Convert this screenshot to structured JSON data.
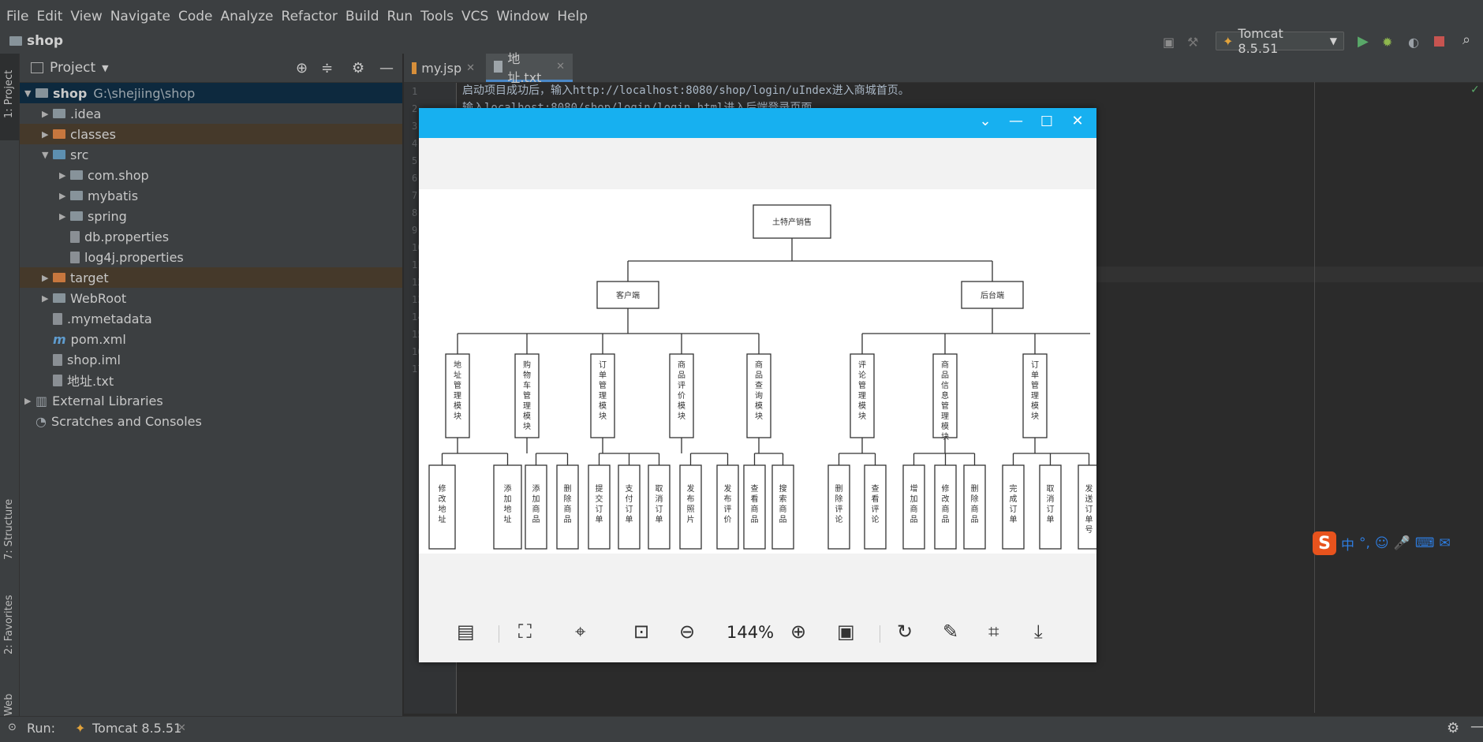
{
  "menu": [
    "File",
    "Edit",
    "View",
    "Navigate",
    "Code",
    "Analyze",
    "Refactor",
    "Build",
    "Run",
    "Tools",
    "VCS",
    "Window",
    "Help"
  ],
  "project_name": "shop",
  "run_config": "Tomcat 8.5.51",
  "project_panel": {
    "title": "Project",
    "tree": [
      {
        "label": "shop",
        "extra": "G:\\shejiing\\shop",
        "indent": 0,
        "arrow": "▼",
        "icon": "folder",
        "selected": true
      },
      {
        "label": ".idea",
        "indent": 1,
        "arrow": "▶",
        "icon": "folder"
      },
      {
        "label": "classes",
        "indent": 1,
        "arrow": "▶",
        "icon": "folder-orange",
        "excluded": true
      },
      {
        "label": "src",
        "indent": 1,
        "arrow": "▼",
        "icon": "folder-blue"
      },
      {
        "label": "com.shop",
        "indent": 2,
        "arrow": "▶",
        "icon": "package"
      },
      {
        "label": "mybatis",
        "indent": 2,
        "arrow": "▶",
        "icon": "package"
      },
      {
        "label": "spring",
        "indent": 2,
        "arrow": "▶",
        "icon": "package"
      },
      {
        "label": "db.properties",
        "indent": 2,
        "arrow": "",
        "icon": "file"
      },
      {
        "label": "log4j.properties",
        "indent": 2,
        "arrow": "",
        "icon": "file"
      },
      {
        "label": "target",
        "indent": 1,
        "arrow": "▶",
        "icon": "folder-orange",
        "excluded": true
      },
      {
        "label": "WebRoot",
        "indent": 1,
        "arrow": "▶",
        "icon": "folder"
      },
      {
        "label": ".mymetadata",
        "indent": 1,
        "arrow": "",
        "icon": "file"
      },
      {
        "label": "pom.xml",
        "indent": 1,
        "arrow": "",
        "icon": "maven"
      },
      {
        "label": "shop.iml",
        "indent": 1,
        "arrow": "",
        "icon": "file"
      },
      {
        "label": "地址.txt",
        "indent": 1,
        "arrow": "",
        "icon": "file"
      },
      {
        "label": "External Libraries",
        "indent": 0,
        "arrow": "▶",
        "icon": "library"
      },
      {
        "label": "Scratches and Consoles",
        "indent": 0,
        "arrow": "",
        "icon": "scratch"
      }
    ]
  },
  "side_labels": {
    "project": "1: Project",
    "structure": "7: Structure",
    "favorites": "2: Favorites",
    "web": "Web"
  },
  "tabs": [
    {
      "label": "my.jsp"
    },
    {
      "label": "地址.txt",
      "active": true
    }
  ],
  "code_lines": [
    "启动项目成功后，输入http://localhost:8080/shop/login/uIndex进入商城首页。",
    "输入localhost:8080/shop/login/login.html进入后端登录页面"
  ],
  "line_numbers": [
    "1",
    "2",
    "3",
    "4",
    "5",
    "6",
    "7",
    "8",
    "9",
    "10",
    "11",
    "12",
    "13",
    "14",
    "15",
    "16",
    "17"
  ],
  "run_bar": {
    "label": "Run:",
    "tab": "Tomcat 8.5.51"
  },
  "ime": {
    "lang": "中",
    "punct": "°,"
  },
  "viewer": {
    "zoom": "144%",
    "diagram": {
      "root": "土特产销售",
      "client": "客户端",
      "admin": "后台端",
      "client_modules": [
        {
          "name": "地址管理模块",
          "children": [
            "修改地址",
            "添加地址"
          ]
        },
        {
          "name": "购物车管理模块",
          "children": [
            "添加商品",
            "删除商品"
          ]
        },
        {
          "name": "订单管理模块",
          "children": [
            "提交订单",
            "支付订单",
            "取消订单"
          ]
        },
        {
          "name": "商品评价模块",
          "children": [
            "发布照片",
            "发布评价"
          ]
        },
        {
          "name": "商品查询模块",
          "children": [
            "查看商品",
            "搜索商品"
          ]
        }
      ],
      "admin_modules": [
        {
          "name": "评论管理模块",
          "children": [
            "删除评论",
            "查看评论"
          ]
        },
        {
          "name": "商品信息管理模块",
          "children": [
            "增加商品",
            "修改商品",
            "删除商品"
          ]
        },
        {
          "name": "订单管理模块",
          "children": [
            "完成订单",
            "取消订单",
            "发送订单号"
          ]
        }
      ]
    }
  }
}
